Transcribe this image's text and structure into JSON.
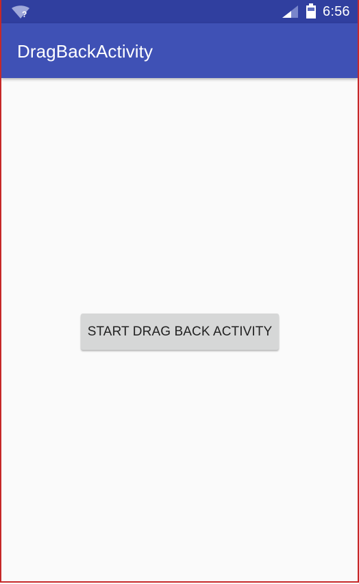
{
  "status_bar": {
    "time": "6:56",
    "wifi_badge": "?",
    "icons": [
      "wifi-unknown-icon",
      "cell-signal-icon",
      "battery-icon"
    ]
  },
  "app_bar": {
    "title": "DragBackActivity"
  },
  "main": {
    "button_label": "START DRAG BACK ACTIVITY"
  },
  "colors": {
    "status_bar": "#303f9f",
    "app_bar": "#3f51b5",
    "background": "#fafafa",
    "button": "#d6d7d7",
    "frame_border": "#c62828"
  }
}
